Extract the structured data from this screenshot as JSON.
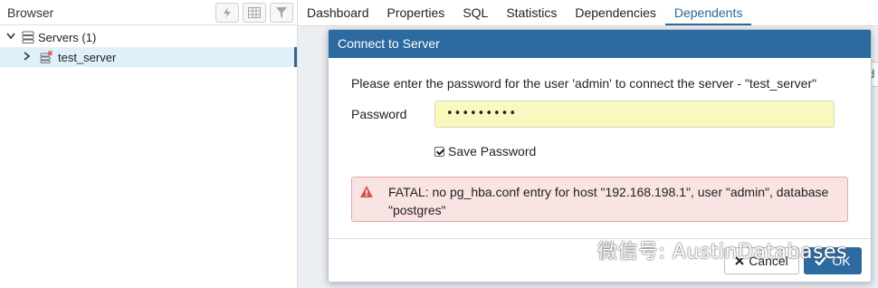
{
  "browser": {
    "title": "Browser",
    "tree": [
      {
        "label": "Servers (1)"
      },
      {
        "label": "test_server"
      }
    ]
  },
  "tabs": [
    {
      "label": "Dashboard"
    },
    {
      "label": "Properties"
    },
    {
      "label": "SQL"
    },
    {
      "label": "Statistics"
    },
    {
      "label": "Dependencies"
    },
    {
      "label": "Dependents"
    }
  ],
  "behind_panel": {
    "text": "d"
  },
  "dialog": {
    "title": "Connect to Server",
    "message": "Please enter the password for the user 'admin' to connect the server - \"test_server\"",
    "password_label": "Password",
    "password_value": "•••••••••",
    "save_password_label": "Save Password",
    "error": "FATAL: no pg_hba.conf entry for host \"192.168.198.1\", user \"admin\", database \"postgres\"",
    "cancel_label": "Cancel",
    "ok_label": "OK"
  },
  "watermark": {
    "text": "微信号: AustinDatabases"
  },
  "colors": {
    "accent": "#2c6aa0",
    "selected_row": "#dff0fb",
    "password_bg": "#f9f9bf",
    "error_bg": "#f9e3e3",
    "error_icon": "#d9534f"
  }
}
